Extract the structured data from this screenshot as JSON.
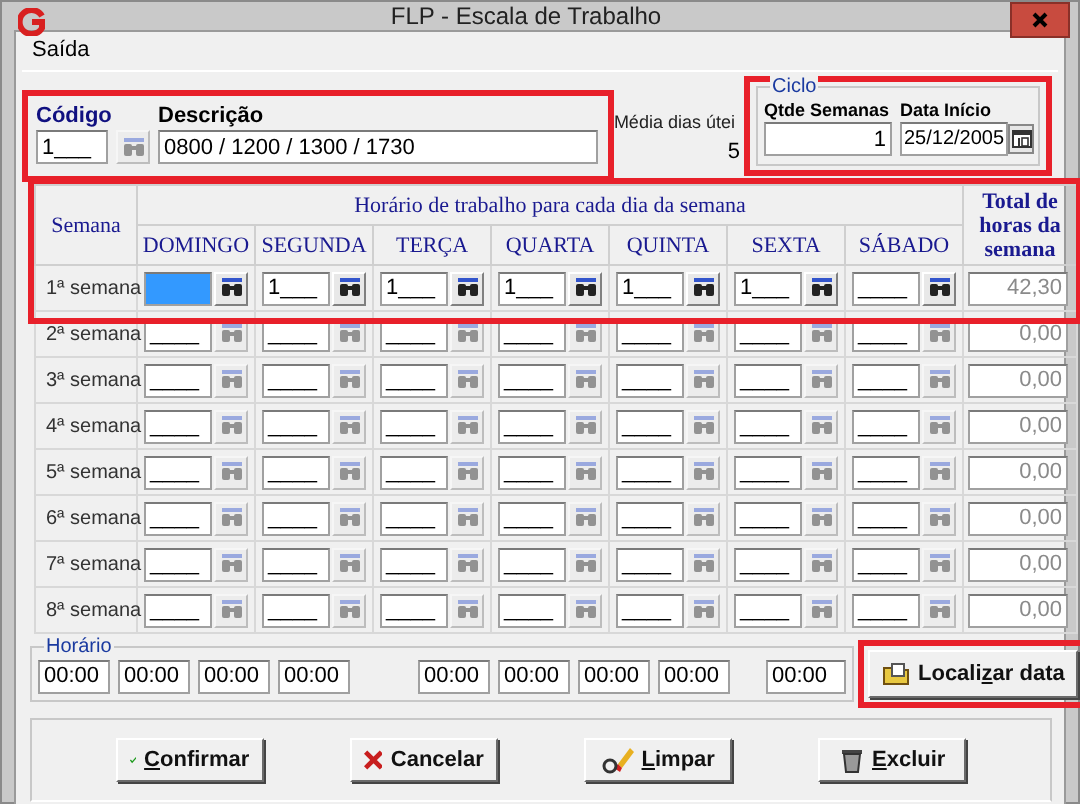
{
  "window": {
    "title": "FLP - Escala de Trabalho"
  },
  "menu": [
    {
      "label": "Saída"
    }
  ],
  "code": {
    "label": "Código",
    "value": "1___",
    "highlighted": true
  },
  "description": {
    "label": "Descrição",
    "value": "0800 / 1200 / 1300 / 1730"
  },
  "average": {
    "label": "Média dias útei",
    "value": "5"
  },
  "cycle": {
    "title": "Ciclo",
    "highlighted": true,
    "weeks_label": "Qtde Semanas",
    "weeks_value": "1",
    "start_label": "Data Início",
    "start_value": "25/12/2005"
  },
  "schedule": {
    "week_header": "Semana",
    "days_header": "Horário de trabalho para cada dia da semana",
    "total_header": "Total de horas da semana",
    "days": [
      "DOMINGO",
      "SEGUNDA",
      "TERÇA",
      "QUARTA",
      "QUINTA",
      "SEXTA",
      "SÁBADO"
    ],
    "weeks": [
      {
        "label": "1ª semana",
        "highlighted": true,
        "disabled": false,
        "total": "42,30",
        "cells": [
          {
            "selected": true
          },
          {
            "value": "1___",
            "selected": false
          },
          {
            "value": "1___",
            "selected": false
          },
          {
            "value": "1___",
            "selected": false
          },
          {
            "value": "1___",
            "selected": false
          },
          {
            "value": "1___",
            "selected": false
          },
          {
            "value": "____",
            "selected": false
          }
        ]
      },
      {
        "label": "2ª semana",
        "highlighted": false,
        "disabled": true,
        "total": "0,00",
        "cells": [
          {
            "value": "____",
            "selected": false
          },
          {
            "value": "____",
            "selected": false
          },
          {
            "value": "____",
            "selected": false
          },
          {
            "value": "____",
            "selected": false
          },
          {
            "value": "____",
            "selected": false
          },
          {
            "value": "____",
            "selected": false
          },
          {
            "value": "____",
            "selected": false
          }
        ]
      },
      {
        "label": "3ª semana",
        "highlighted": false,
        "disabled": true,
        "total": "0,00",
        "cells": [
          {
            "value": "____",
            "selected": false
          },
          {
            "value": "____",
            "selected": false
          },
          {
            "value": "____",
            "selected": false
          },
          {
            "value": "____",
            "selected": false
          },
          {
            "value": "____",
            "selected": false
          },
          {
            "value": "____",
            "selected": false
          },
          {
            "value": "____",
            "selected": false
          }
        ]
      },
      {
        "label": "4ª semana",
        "highlighted": false,
        "disabled": true,
        "total": "0,00",
        "cells": [
          {
            "value": "____",
            "selected": false
          },
          {
            "value": "____",
            "selected": false
          },
          {
            "value": "____",
            "selected": false
          },
          {
            "value": "____",
            "selected": false
          },
          {
            "value": "____",
            "selected": false
          },
          {
            "value": "____",
            "selected": false
          },
          {
            "value": "____",
            "selected": false
          }
        ]
      },
      {
        "label": "5ª semana",
        "highlighted": false,
        "disabled": true,
        "total": "0,00",
        "cells": [
          {
            "value": "____",
            "selected": false
          },
          {
            "value": "____",
            "selected": false
          },
          {
            "value": "____",
            "selected": false
          },
          {
            "value": "____",
            "selected": false
          },
          {
            "value": "____",
            "selected": false
          },
          {
            "value": "____",
            "selected": false
          },
          {
            "value": "____",
            "selected": false
          }
        ]
      },
      {
        "label": "6ª semana",
        "highlighted": false,
        "disabled": true,
        "total": "0,00",
        "cells": [
          {
            "value": "____",
            "selected": false
          },
          {
            "value": "____",
            "selected": false
          },
          {
            "value": "____",
            "selected": false
          },
          {
            "value": "____",
            "selected": false
          },
          {
            "value": "____",
            "selected": false
          },
          {
            "value": "____",
            "selected": false
          },
          {
            "value": "____",
            "selected": false
          }
        ]
      },
      {
        "label": "7ª semana",
        "highlighted": false,
        "disabled": true,
        "total": "0,00",
        "cells": [
          {
            "value": "____",
            "selected": false
          },
          {
            "value": "____",
            "selected": false
          },
          {
            "value": "____",
            "selected": false
          },
          {
            "value": "____",
            "selected": false
          },
          {
            "value": "____",
            "selected": false
          },
          {
            "value": "____",
            "selected": false
          },
          {
            "value": "____",
            "selected": false
          }
        ]
      },
      {
        "label": "8ª semana",
        "highlighted": false,
        "disabled": true,
        "total": "0,00",
        "cells": [
          {
            "value": "____",
            "selected": false
          },
          {
            "value": "____",
            "selected": false
          },
          {
            "value": "____",
            "selected": false
          },
          {
            "value": "____",
            "selected": false
          },
          {
            "value": "____",
            "selected": false
          },
          {
            "value": "____",
            "selected": false
          },
          {
            "value": "____",
            "selected": false
          }
        ]
      }
    ]
  },
  "hours": {
    "title": "Horário",
    "times": [
      "00:00",
      "00:00",
      "00:00",
      "00:00",
      "00:00",
      "00:00",
      "00:00",
      "00:00",
      "00:00"
    ]
  },
  "locate_button": {
    "before": "Locali",
    "key": "z",
    "after": "ar data",
    "highlighted": true
  },
  "buttons": [
    {
      "kind": "confirm",
      "key": "C",
      "after": "onfirmar"
    },
    {
      "kind": "cancel",
      "after": "Cancelar"
    },
    {
      "kind": "clear",
      "key": "L",
      "after": "impar"
    },
    {
      "kind": "delete",
      "key": "E",
      "after": "xcluir"
    }
  ]
}
